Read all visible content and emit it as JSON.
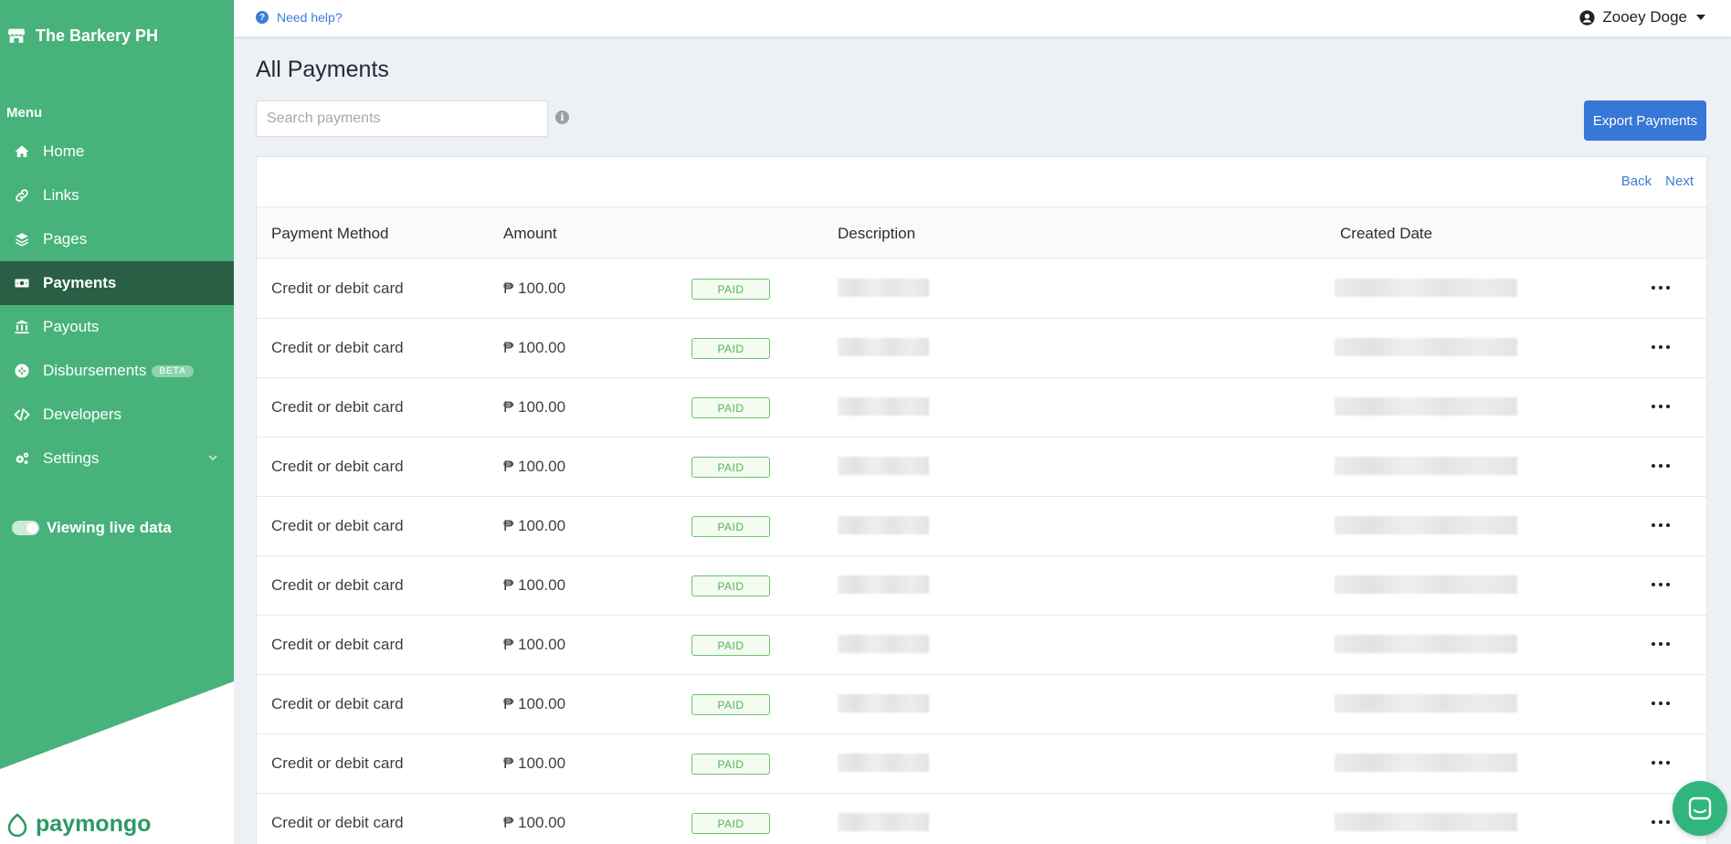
{
  "sidebar": {
    "brand": "The Barkery PH",
    "menu_label": "Menu",
    "items": [
      {
        "label": "Home",
        "icon": "home-icon"
      },
      {
        "label": "Links",
        "icon": "link-icon"
      },
      {
        "label": "Pages",
        "icon": "layers-icon"
      },
      {
        "label": "Payments",
        "icon": "money-icon",
        "active": true
      },
      {
        "label": "Payouts",
        "icon": "bank-icon"
      },
      {
        "label": "Disbursements",
        "icon": "disbursement-icon",
        "badge": "BETA"
      },
      {
        "label": "Developers",
        "icon": "code-icon"
      },
      {
        "label": "Settings",
        "icon": "gears-icon"
      }
    ],
    "live_toggle_label": "Viewing live data",
    "logo_text": "paymongo"
  },
  "topbar": {
    "help_label": "Need help?",
    "user_name": "Zooey Doge"
  },
  "main": {
    "title": "All Payments",
    "search_placeholder": "Search payments",
    "export_label": "Export Payments",
    "pager": {
      "back": "Back",
      "next": "Next"
    },
    "columns": [
      "Payment Method",
      "Amount",
      "Description",
      "Created Date"
    ],
    "rows": [
      {
        "method": "Credit or debit card",
        "amount": "₱ 100.00",
        "status": "PAID"
      },
      {
        "method": "Credit or debit card",
        "amount": "₱ 100.00",
        "status": "PAID"
      },
      {
        "method": "Credit or debit card",
        "amount": "₱ 100.00",
        "status": "PAID"
      },
      {
        "method": "Credit or debit card",
        "amount": "₱ 100.00",
        "status": "PAID"
      },
      {
        "method": "Credit or debit card",
        "amount": "₱ 100.00",
        "status": "PAID"
      },
      {
        "method": "Credit or debit card",
        "amount": "₱ 100.00",
        "status": "PAID"
      },
      {
        "method": "Credit or debit card",
        "amount": "₱ 100.00",
        "status": "PAID"
      },
      {
        "method": "Credit or debit card",
        "amount": "₱ 100.00",
        "status": "PAID"
      },
      {
        "method": "Credit or debit card",
        "amount": "₱ 100.00",
        "status": "PAID"
      },
      {
        "method": "Credit or debit card",
        "amount": "₱ 100.00",
        "status": "PAID"
      }
    ]
  },
  "colors": {
    "sidebar": "#47b37a",
    "sidebar_active": "#2a5f45",
    "accent_blue": "#3777d6",
    "paid_green": "#52b552"
  }
}
